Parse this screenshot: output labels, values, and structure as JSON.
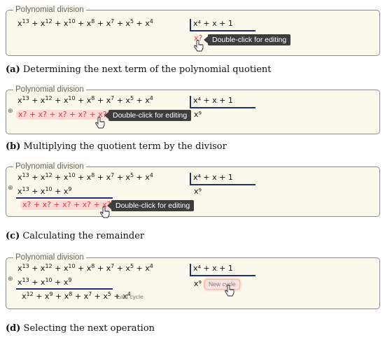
{
  "panel_title": "Polynomial division",
  "dividend": {
    "parts": [
      [
        "x",
        "13"
      ],
      [
        "x",
        "12"
      ],
      [
        "x",
        "10"
      ],
      [
        "x",
        "8"
      ],
      [
        "x",
        "7"
      ],
      [
        "x",
        "5"
      ],
      [
        "x",
        "4"
      ]
    ]
  },
  "divisor": "x⁴ + x + 1",
  "quotient_term": "x⁹",
  "product": "x¹³ + x¹⁰ + x⁹",
  "remainder": "x¹² + x⁹ + x⁸ + x⁷ + x⁵ + x⁴",
  "placeholder_term": "x?",
  "placeholder_row": "x? + x? + x? + x? + x? + x?",
  "tooltip": "Double-click for editing",
  "new_cycle": "New cycle",
  "last_cycle": "Last cycle",
  "captions": [
    {
      "label": "(a)",
      "text": " Determining the next term of the polynomial quotient"
    },
    {
      "label": "(b)",
      "text": " Multiplying the quotient term by the divisor"
    },
    {
      "label": "(c)",
      "text": " Calculating the remainder"
    },
    {
      "label": "(d)",
      "text": " Selecting the next operation"
    }
  ],
  "colors": {
    "panel_bg": "#fbf8ec",
    "accent_line": "#1f2f7a",
    "placeholder_red": "#e53a3a",
    "tooltip_bg": "#3d3d3d"
  }
}
